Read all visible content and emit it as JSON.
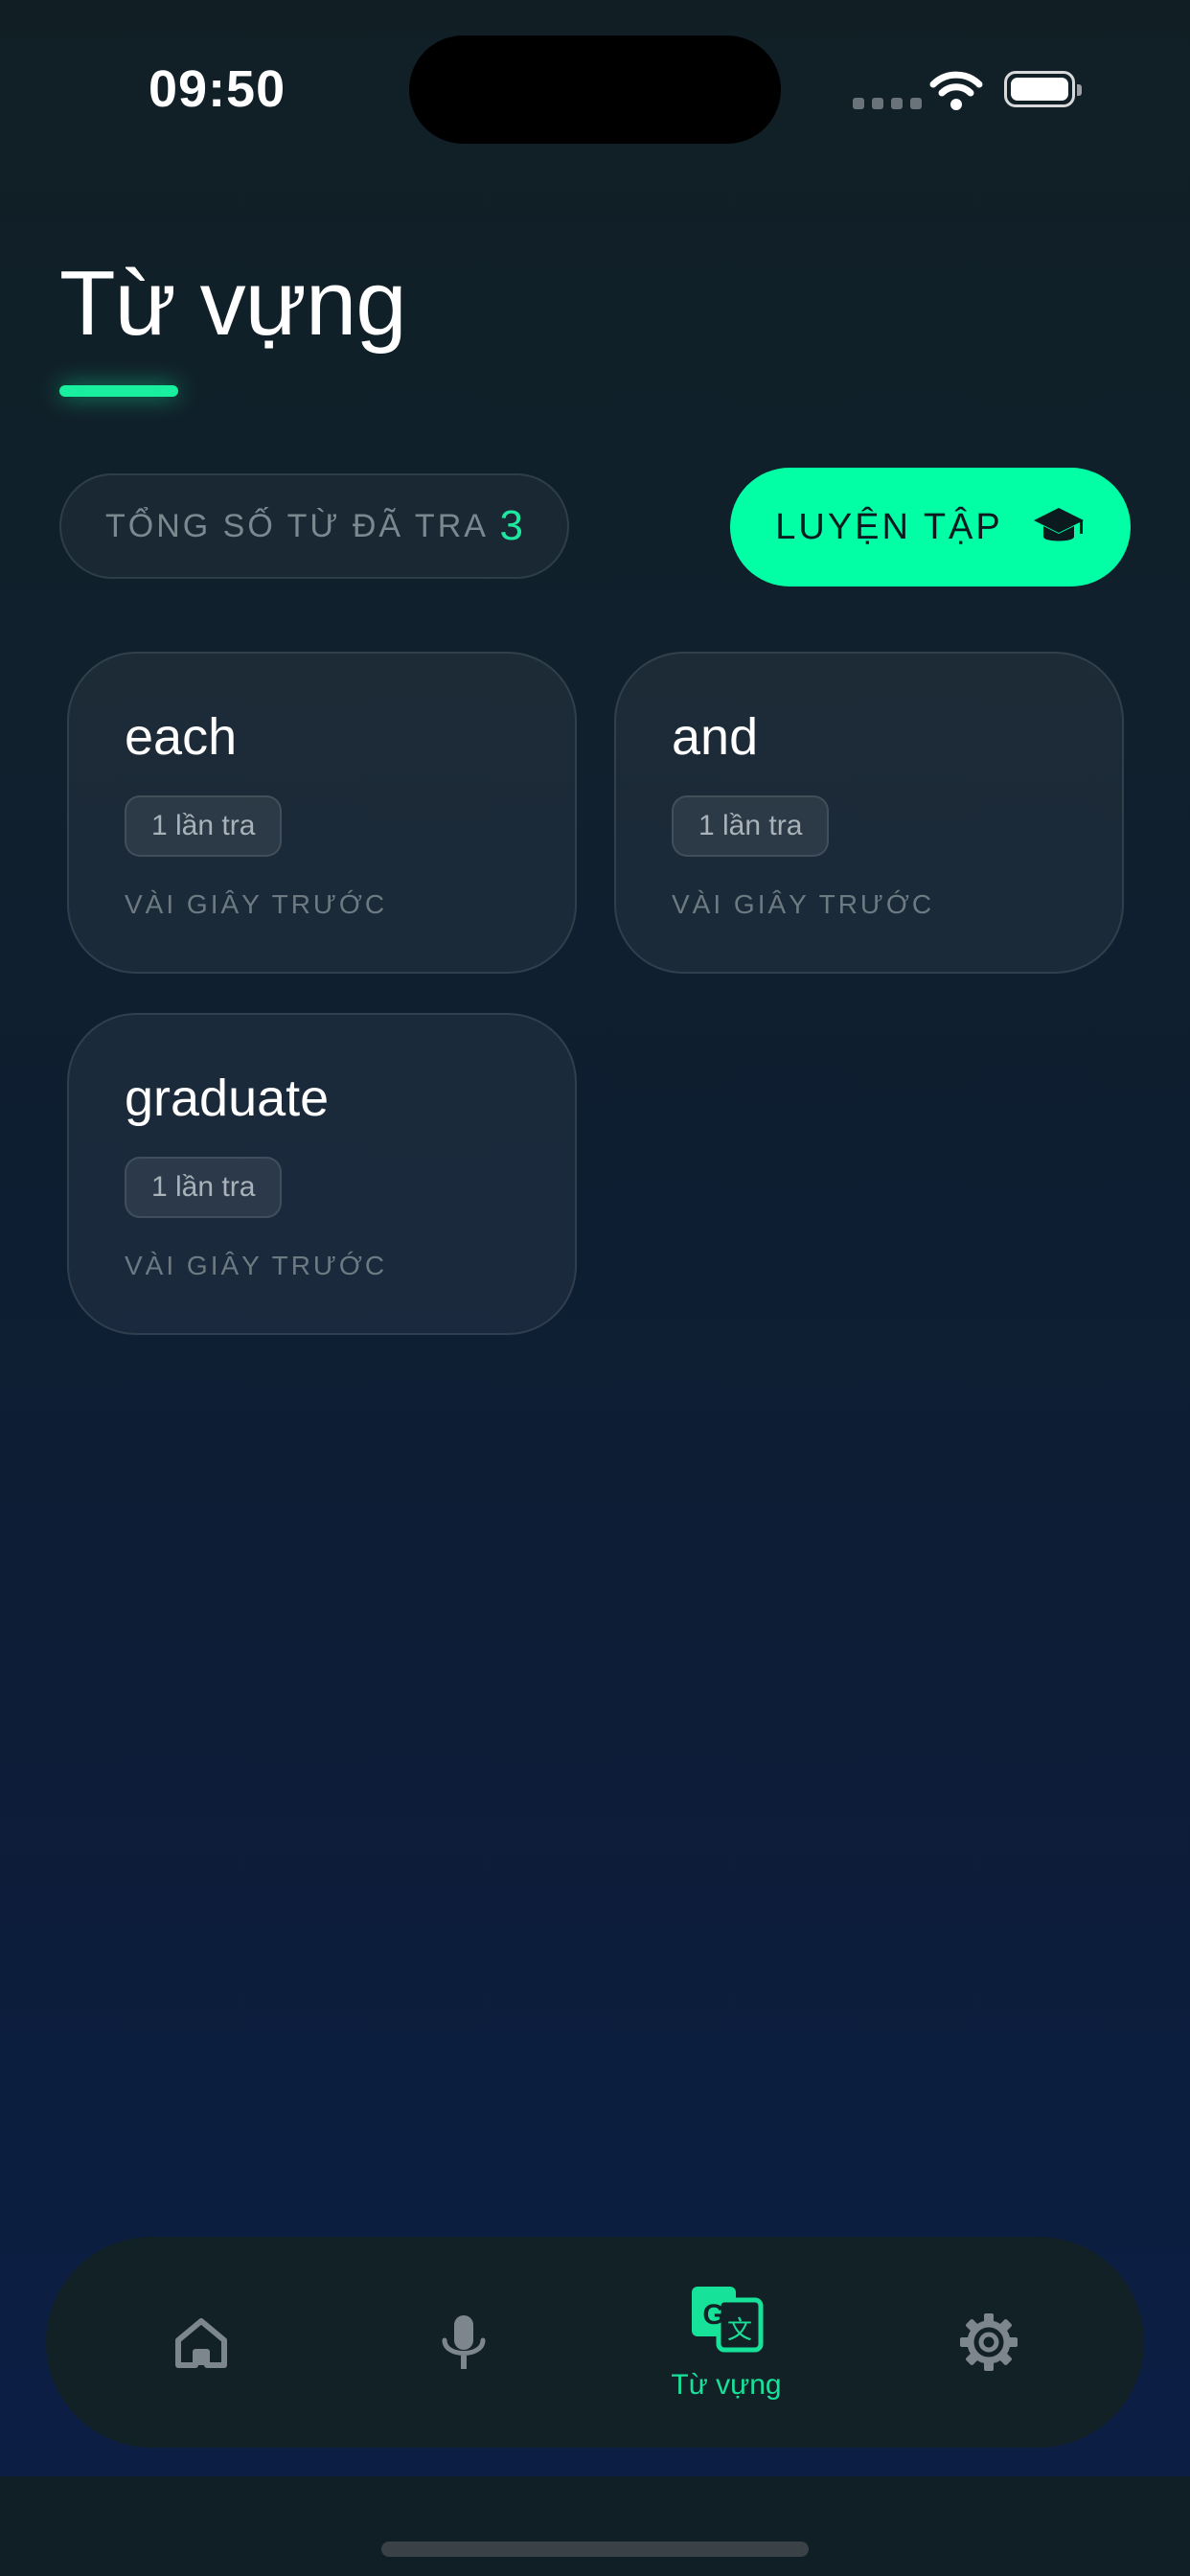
{
  "status_bar": {
    "time": "09:50"
  },
  "header": {
    "title": "Từ vựng"
  },
  "stats": {
    "label": "TỔNG SỐ TỪ ĐÃ TRA",
    "count": "3"
  },
  "practice": {
    "label": "LUYỆN TẬP",
    "icon": "graduation-cap-icon"
  },
  "words": [
    {
      "word": "each",
      "lookups": "1 lần tra",
      "time": "VÀI GIÂY TRƯỚC"
    },
    {
      "word": "and",
      "lookups": "1 lần tra",
      "time": "VÀI GIÂY TRƯỚC"
    },
    {
      "word": "graduate",
      "lookups": "1 lần tra",
      "time": "VÀI GIÂY TRƯỚC"
    }
  ],
  "nav": {
    "items": [
      {
        "icon": "home-icon",
        "label": "",
        "active": false
      },
      {
        "icon": "microphone-icon",
        "label": "",
        "active": false
      },
      {
        "icon": "translate-icon",
        "label": "Từ vựng",
        "active": true
      },
      {
        "icon": "settings-gear-icon",
        "label": "",
        "active": false
      }
    ]
  },
  "colors": {
    "accent": "#02ffa6",
    "accent_text": "#17e29a",
    "inactive_icon": "#7d868c",
    "background_top": "#111f25",
    "background_bottom": "#0c1e46"
  }
}
